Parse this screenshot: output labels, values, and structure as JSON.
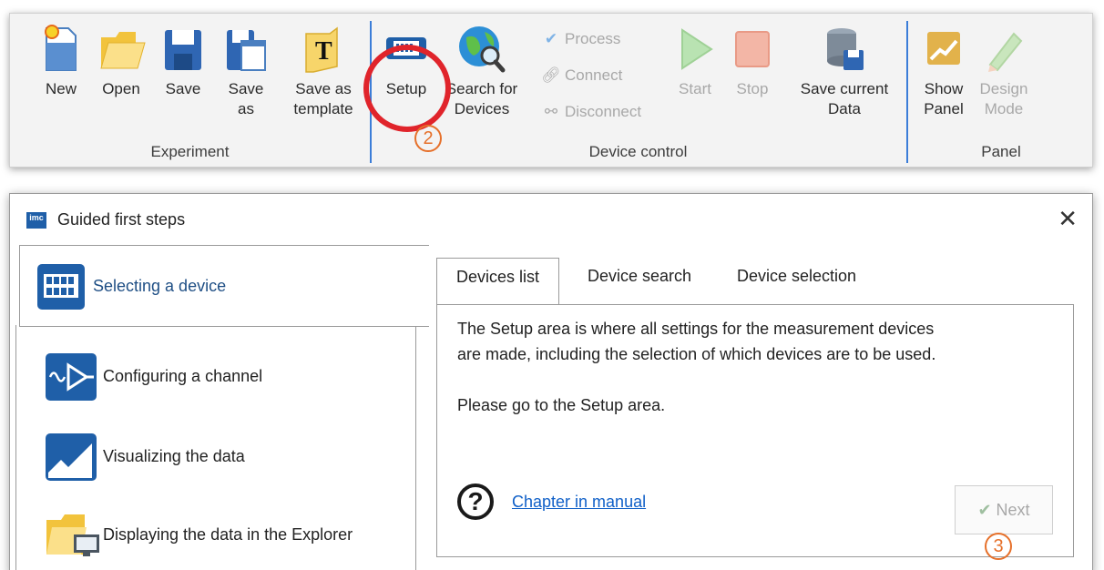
{
  "ribbon": {
    "experiment": {
      "label": "Experiment",
      "buttons": [
        {
          "label": "New",
          "icon": "new-document-icon"
        },
        {
          "label": "Open",
          "icon": "folder-open-icon"
        },
        {
          "label": "Save",
          "icon": "floppy-disk-icon"
        },
        {
          "label": "Save as",
          "icon": "save-as-icon"
        },
        {
          "label": "Save as template",
          "icon": "template-icon"
        }
      ]
    },
    "device_control": {
      "label": "Device control",
      "buttons": [
        {
          "label": "Setup",
          "icon": "device-setup-icon"
        },
        {
          "label": "Search for Devices",
          "icon": "globe-search-icon"
        },
        {
          "label": "Start",
          "icon": "play-icon"
        },
        {
          "label": "Stop",
          "icon": "stop-icon"
        },
        {
          "label": "Save current Data",
          "icon": "database-save-icon"
        }
      ],
      "small_buttons": [
        {
          "label": "Process",
          "icon": "checkmark-icon"
        },
        {
          "label": "Connect",
          "icon": "link-icon"
        },
        {
          "label": "Disconnect",
          "icon": "unlink-icon"
        }
      ]
    },
    "panel": {
      "label": "Panel",
      "buttons": [
        {
          "label": "Show Panel",
          "icon": "panel-chart-icon"
        },
        {
          "label": "Design Mode",
          "icon": "pencil-icon"
        }
      ]
    },
    "callout_2": "2"
  },
  "dialog": {
    "title": "Guided first steps",
    "close": "✕",
    "steps": [
      {
        "label": "Selecting a device",
        "icon": "device-icon"
      },
      {
        "label": "Configuring a channel",
        "icon": "channel-amplifier-icon"
      },
      {
        "label": "Visualizing the data",
        "icon": "chart-icon"
      },
      {
        "label": "Displaying the data in the Explorer",
        "icon": "explorer-folder-icon"
      }
    ],
    "tabs": [
      "Devices list",
      "Device search",
      "Device selection"
    ],
    "content": {
      "line1": "The Setup area is where all settings for the measurement devices",
      "line2": "are made, including the selection of which devices are to be used.",
      "line3": "Please go to the Setup area.",
      "help_link": "Chapter in manual",
      "next": "Next"
    },
    "callout_3": "3"
  },
  "colors": {
    "accent_blue": "#3b7dd8",
    "highlight_red": "#e0242b",
    "callout_orange": "#e6702a",
    "link_blue": "#1060c8"
  }
}
